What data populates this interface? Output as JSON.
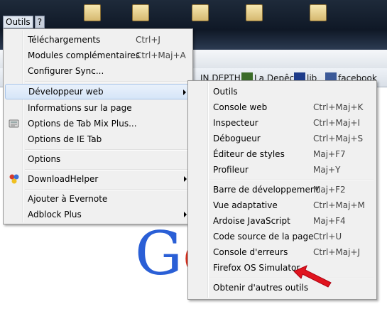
{
  "menubar": {
    "items": [
      "Outils",
      "?"
    ]
  },
  "background": {
    "bookmarks": [
      "IN DEPTH",
      "La Depêche",
      "lib",
      "facebook"
    ],
    "logo_letters": [
      "G",
      "o"
    ]
  },
  "tools_menu": {
    "items": [
      {
        "label": "Téléchargements",
        "accel": "Ctrl+J"
      },
      {
        "label": "Modules complémentaires",
        "accel": "Ctrl+Maj+A"
      },
      {
        "label": "Configurer Sync..."
      },
      {
        "label": "Développeur web",
        "submenu": true
      },
      {
        "label": "Informations sur la page"
      },
      {
        "label": "Options de Tab Mix Plus..."
      },
      {
        "label": "Options de IE Tab"
      },
      {
        "label": "Options"
      },
      {
        "label": "DownloadHelper",
        "submenu": true
      },
      {
        "label": "Ajouter à Evernote"
      },
      {
        "label": "Adblock Plus",
        "submenu": true
      }
    ]
  },
  "dev_menu": {
    "items": [
      {
        "label": "Outils"
      },
      {
        "label": "Console web",
        "accel": "Ctrl+Maj+K"
      },
      {
        "label": "Inspecteur",
        "accel": "Ctrl+Maj+I"
      },
      {
        "label": "Débogueur",
        "accel": "Ctrl+Maj+S"
      },
      {
        "label": "Éditeur de styles",
        "accel": "Maj+F7"
      },
      {
        "label": "Profileur",
        "accel": "Maj+Y"
      },
      {
        "label": "Barre de développement",
        "accel": "Maj+F2"
      },
      {
        "label": "Vue adaptative",
        "accel": "Ctrl+Maj+M"
      },
      {
        "label": "Ardoise JavaScript",
        "accel": "Maj+F4"
      },
      {
        "label": "Code source de la page",
        "accel": "Ctrl+U"
      },
      {
        "label": "Console d'erreurs",
        "accel": "Ctrl+Maj+J"
      },
      {
        "label": "Firefox OS Simulator"
      },
      {
        "label": "Obtenir d'autres outils"
      }
    ]
  },
  "colors": {
    "hover_bg": "#d6e5f8",
    "arrow": "#e0141e",
    "google_blue": "#2a5fd6",
    "google_red": "#d62c1a"
  }
}
